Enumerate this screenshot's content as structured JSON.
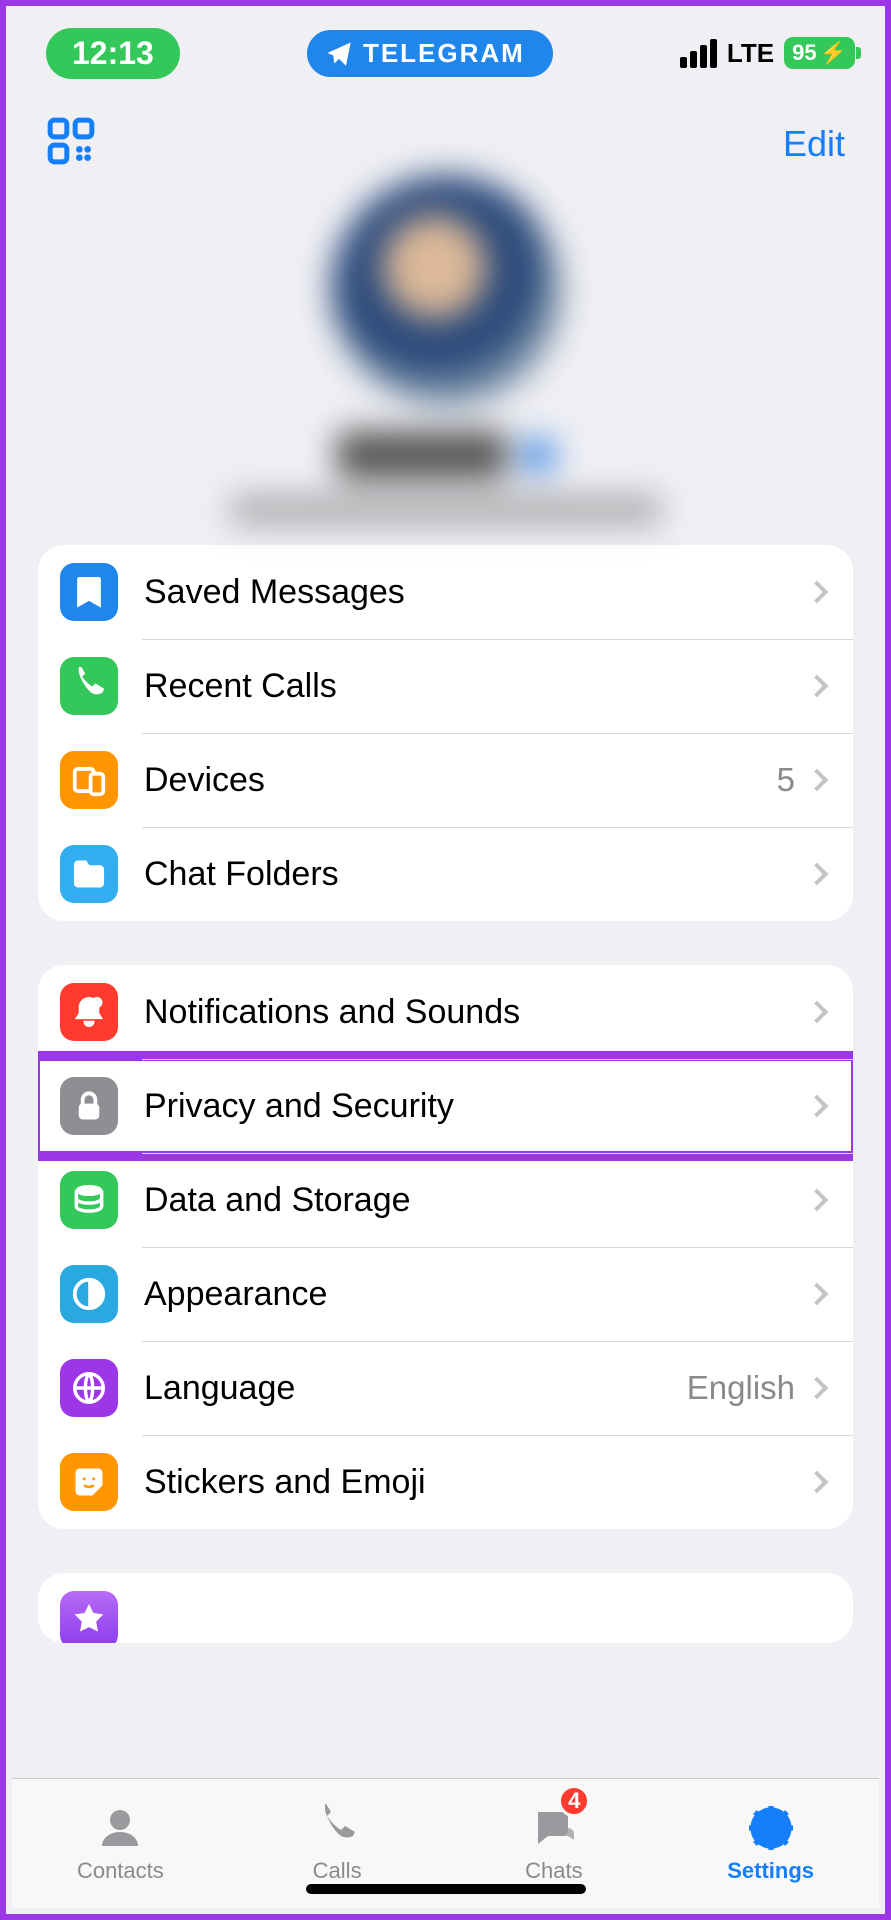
{
  "statusbar": {
    "clock": "12:13",
    "app_pill": "TELEGRAM",
    "network": "LTE",
    "battery": "95"
  },
  "header": {
    "edit_label": "Edit"
  },
  "group1": [
    {
      "id": "saved-messages",
      "label": "Saved Messages",
      "color": "#1f86ec",
      "icon": "bookmark"
    },
    {
      "id": "recent-calls",
      "label": "Recent Calls",
      "color": "#34c759",
      "icon": "phone"
    },
    {
      "id": "devices",
      "label": "Devices",
      "value": "5",
      "color": "#ff9500",
      "icon": "devices"
    },
    {
      "id": "chat-folders",
      "label": "Chat Folders",
      "color": "#32aef0",
      "icon": "folder"
    }
  ],
  "group2": [
    {
      "id": "notifications",
      "label": "Notifications and Sounds",
      "color": "#ff3b30",
      "icon": "bell"
    },
    {
      "id": "privacy",
      "label": "Privacy and Security",
      "color": "#8e8e93",
      "icon": "lock",
      "highlight": true
    },
    {
      "id": "data-storage",
      "label": "Data and Storage",
      "color": "#34c759",
      "icon": "stack"
    },
    {
      "id": "appearance",
      "label": "Appearance",
      "color": "#2aa9e0",
      "icon": "contrast"
    },
    {
      "id": "language",
      "label": "Language",
      "value": "English",
      "color": "#9b37e6",
      "icon": "globe"
    },
    {
      "id": "stickers",
      "label": "Stickers and Emoji",
      "color": "#ff9500",
      "icon": "sticker"
    }
  ],
  "tabs": {
    "contacts": "Contacts",
    "calls": "Calls",
    "chats": "Chats",
    "chats_badge": "4",
    "settings": "Settings"
  }
}
